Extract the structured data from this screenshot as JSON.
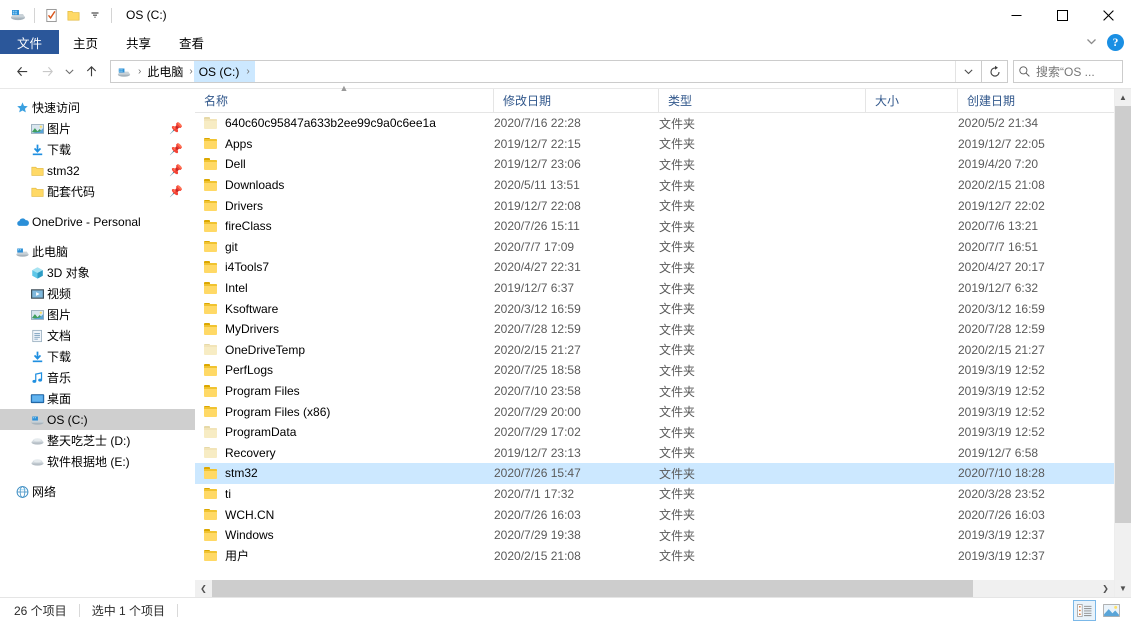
{
  "window": {
    "title": "OS (C:)",
    "quick_access_toolbar": [
      {
        "icon": "drive-icon",
        "name": "drive"
      },
      {
        "icon": "properties-icon",
        "name": "properties"
      },
      {
        "icon": "new-folder-icon",
        "name": "new-folder"
      },
      {
        "icon": "chevron-down-icon",
        "name": "customize-qat"
      }
    ],
    "controls": {
      "minimize": "—",
      "maximize": "□",
      "close": "✕"
    }
  },
  "ribbon": {
    "tabs": [
      {
        "label": "文件",
        "active": true
      },
      {
        "label": "主页",
        "active": false
      },
      {
        "label": "共享",
        "active": false
      },
      {
        "label": "查看",
        "active": false
      }
    ],
    "collapse_icon": "chevron-down-icon",
    "help_label": "?"
  },
  "navbar": {
    "back_icon": "arrow-left-icon",
    "forward_icon": "arrow-right-icon",
    "recent_icon": "chevron-down-icon",
    "up_icon": "arrow-up-icon",
    "breadcrumbs": [
      {
        "label": "",
        "icon": "computer-icon",
        "active": false
      },
      {
        "label": "此电脑",
        "active": false
      },
      {
        "label": "OS (C:)",
        "active": true
      }
    ],
    "address_dropdown_icon": "chevron-down-icon",
    "refresh_icon": "refresh-icon",
    "search": {
      "icon": "search-icon",
      "placeholder": "搜索“OS ..."
    }
  },
  "sidebar": {
    "items": [
      {
        "label": "快速访问",
        "icon": "star-icon",
        "level": 0,
        "pinned": false,
        "selected": false
      },
      {
        "label": "图片",
        "icon": "pictures-icon",
        "level": 1,
        "pinned": true,
        "selected": false
      },
      {
        "label": "下载",
        "icon": "downloads-icon",
        "level": 1,
        "pinned": true,
        "selected": false
      },
      {
        "label": "stm32",
        "icon": "folder-icon",
        "level": 1,
        "pinned": true,
        "selected": false
      },
      {
        "label": "配套代码",
        "icon": "folder-icon",
        "level": 1,
        "pinned": true,
        "selected": false
      },
      {
        "label": "OneDrive - Personal",
        "icon": "onedrive-icon",
        "level": 0,
        "pinned": false,
        "selected": false,
        "gap_before": true
      },
      {
        "label": "此电脑",
        "icon": "computer-icon",
        "level": 0,
        "pinned": false,
        "selected": false,
        "gap_before": true
      },
      {
        "label": "3D 对象",
        "icon": "3d-objects-icon",
        "level": 1,
        "pinned": false,
        "selected": false
      },
      {
        "label": "视频",
        "icon": "videos-icon",
        "level": 1,
        "pinned": false,
        "selected": false
      },
      {
        "label": "图片",
        "icon": "pictures-icon",
        "level": 1,
        "pinned": false,
        "selected": false
      },
      {
        "label": "文档",
        "icon": "documents-icon",
        "level": 1,
        "pinned": false,
        "selected": false
      },
      {
        "label": "下载",
        "icon": "downloads-icon",
        "level": 1,
        "pinned": false,
        "selected": false
      },
      {
        "label": "音乐",
        "icon": "music-icon",
        "level": 1,
        "pinned": false,
        "selected": false
      },
      {
        "label": "桌面",
        "icon": "desktop-icon",
        "level": 1,
        "pinned": false,
        "selected": false
      },
      {
        "label": "OS (C:)",
        "icon": "drive-icon",
        "level": 1,
        "pinned": false,
        "selected": true
      },
      {
        "label": "整天吃芝士 (D:)",
        "icon": "disk-icon",
        "level": 1,
        "pinned": false,
        "selected": false
      },
      {
        "label": "软件根据地 (E:)",
        "icon": "disk-icon",
        "level": 1,
        "pinned": false,
        "selected": false
      },
      {
        "label": "网络",
        "icon": "network-icon",
        "level": 0,
        "pinned": false,
        "selected": false,
        "gap_before": true
      }
    ]
  },
  "file_list": {
    "columns": [
      {
        "label": "名称",
        "key": "name",
        "sorted": true,
        "sort_direction": "asc"
      },
      {
        "label": "修改日期",
        "key": "date"
      },
      {
        "label": "类型",
        "key": "type"
      },
      {
        "label": "大小",
        "key": "size"
      },
      {
        "label": "创建日期",
        "key": "created"
      }
    ],
    "rows": [
      {
        "name": "640c60c95847a633b2ee99c9a0c6ee1a",
        "date": "2020/7/16 22:28",
        "type": "文件夹",
        "size": "",
        "created": "2020/5/2 21:34",
        "selected": false,
        "dim": true
      },
      {
        "name": "Apps",
        "date": "2019/12/7 22:15",
        "type": "文件夹",
        "size": "",
        "created": "2019/12/7 22:05",
        "selected": false,
        "dim": false
      },
      {
        "name": "Dell",
        "date": "2019/12/7 23:06",
        "type": "文件夹",
        "size": "",
        "created": "2019/4/20 7:20",
        "selected": false,
        "dim": false
      },
      {
        "name": "Downloads",
        "date": "2020/5/11 13:51",
        "type": "文件夹",
        "size": "",
        "created": "2020/2/15 21:08",
        "selected": false,
        "dim": false
      },
      {
        "name": "Drivers",
        "date": "2019/12/7 22:08",
        "type": "文件夹",
        "size": "",
        "created": "2019/12/7 22:02",
        "selected": false,
        "dim": false
      },
      {
        "name": "fireClass",
        "date": "2020/7/26 15:11",
        "type": "文件夹",
        "size": "",
        "created": "2020/7/6 13:21",
        "selected": false,
        "dim": false
      },
      {
        "name": "git",
        "date": "2020/7/7 17:09",
        "type": "文件夹",
        "size": "",
        "created": "2020/7/7 16:51",
        "selected": false,
        "dim": false
      },
      {
        "name": "i4Tools7",
        "date": "2020/4/27 22:31",
        "type": "文件夹",
        "size": "",
        "created": "2020/4/27 20:17",
        "selected": false,
        "dim": false
      },
      {
        "name": "Intel",
        "date": "2019/12/7 6:37",
        "type": "文件夹",
        "size": "",
        "created": "2019/12/7 6:32",
        "selected": false,
        "dim": false
      },
      {
        "name": "Ksoftware",
        "date": "2020/3/12 16:59",
        "type": "文件夹",
        "size": "",
        "created": "2020/3/12 16:59",
        "selected": false,
        "dim": false
      },
      {
        "name": "MyDrivers",
        "date": "2020/7/28 12:59",
        "type": "文件夹",
        "size": "",
        "created": "2020/7/28 12:59",
        "selected": false,
        "dim": false
      },
      {
        "name": "OneDriveTemp",
        "date": "2020/2/15 21:27",
        "type": "文件夹",
        "size": "",
        "created": "2020/2/15 21:27",
        "selected": false,
        "dim": true
      },
      {
        "name": "PerfLogs",
        "date": "2020/7/25 18:58",
        "type": "文件夹",
        "size": "",
        "created": "2019/3/19 12:52",
        "selected": false,
        "dim": false
      },
      {
        "name": "Program Files",
        "date": "2020/7/10 23:58",
        "type": "文件夹",
        "size": "",
        "created": "2019/3/19 12:52",
        "selected": false,
        "dim": false
      },
      {
        "name": "Program Files (x86)",
        "date": "2020/7/29 20:00",
        "type": "文件夹",
        "size": "",
        "created": "2019/3/19 12:52",
        "selected": false,
        "dim": false
      },
      {
        "name": "ProgramData",
        "date": "2020/7/29 17:02",
        "type": "文件夹",
        "size": "",
        "created": "2019/3/19 12:52",
        "selected": false,
        "dim": true
      },
      {
        "name": "Recovery",
        "date": "2019/12/7 23:13",
        "type": "文件夹",
        "size": "",
        "created": "2019/12/7 6:58",
        "selected": false,
        "dim": true
      },
      {
        "name": "stm32",
        "date": "2020/7/26 15:47",
        "type": "文件夹",
        "size": "",
        "created": "2020/7/10 18:28",
        "selected": true,
        "dim": false
      },
      {
        "name": "ti",
        "date": "2020/7/1 17:32",
        "type": "文件夹",
        "size": "",
        "created": "2020/3/28 23:52",
        "selected": false,
        "dim": false
      },
      {
        "name": "WCH.CN",
        "date": "2020/7/26 16:03",
        "type": "文件夹",
        "size": "",
        "created": "2020/7/26 16:03",
        "selected": false,
        "dim": false
      },
      {
        "name": "Windows",
        "date": "2020/7/29 19:38",
        "type": "文件夹",
        "size": "",
        "created": "2019/3/19 12:37",
        "selected": false,
        "dim": false
      },
      {
        "name": "用户",
        "date": "2020/2/15 21:08",
        "type": "文件夹",
        "size": "",
        "created": "2019/3/19 12:37",
        "selected": false,
        "dim": false
      }
    ]
  },
  "status_bar": {
    "item_count": "26 个项目",
    "selection": "选中 1 个项目",
    "views": [
      {
        "name": "details-view",
        "active": true
      },
      {
        "name": "large-icons-view",
        "active": false
      }
    ]
  },
  "colors": {
    "selection": "#cce8ff",
    "file_tab": "#2b579a",
    "header_text": "#32588c",
    "folder": "#ffd966"
  }
}
